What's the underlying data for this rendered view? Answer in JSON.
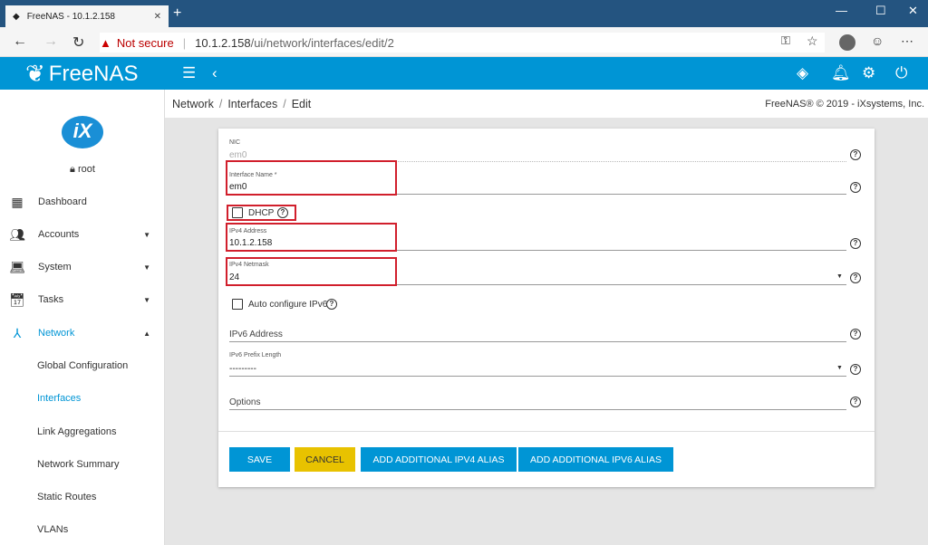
{
  "browser": {
    "tab_title": "FreeNAS - 10.1.2.158",
    "not_secure": "Not secure",
    "url_host": "10.1.2.158",
    "url_path": "/ui/network/interfaces/edit/2"
  },
  "app": {
    "logo": "FreeNAS",
    "brand_color": "#0095d5"
  },
  "sidebar": {
    "user": "root",
    "items": [
      {
        "label": "Dashboard",
        "icon": "dashboard-icon"
      },
      {
        "label": "Accounts",
        "icon": "people-icon"
      },
      {
        "label": "System",
        "icon": "laptop-icon"
      },
      {
        "label": "Tasks",
        "icon": "calendar-icon"
      },
      {
        "label": "Network",
        "icon": "network-icon"
      }
    ],
    "network_sub": [
      "Global Configuration",
      "Interfaces",
      "Link Aggregations",
      "Network Summary",
      "Static Routes",
      "VLANs"
    ]
  },
  "breadcrumb": [
    "Network",
    "Interfaces",
    "Edit"
  ],
  "copyright": "FreeNAS® © 2019 - iXsystems, Inc.",
  "form": {
    "nic_label": "NIC",
    "nic_value": "em0",
    "name_label": "Interface Name *",
    "name_value": "em0",
    "dhcp_label": "DHCP",
    "ipv4_label": "IPv4 Address",
    "ipv4_value": "10.1.2.158",
    "netmask_label": "IPv4 Netmask",
    "netmask_value": "24",
    "autoipv6_label": "Auto configure IPv6",
    "ipv6_placeholder": "IPv6 Address",
    "prefix_label": "IPv6 Prefix Length",
    "prefix_value": "---------",
    "options_placeholder": "Options"
  },
  "buttons": {
    "save": "SAVE",
    "cancel": "CANCEL",
    "add_ipv4": "ADD ADDITIONAL IPV4 ALIAS",
    "add_ipv6": "ADD ADDITIONAL IPV6 ALIAS"
  }
}
